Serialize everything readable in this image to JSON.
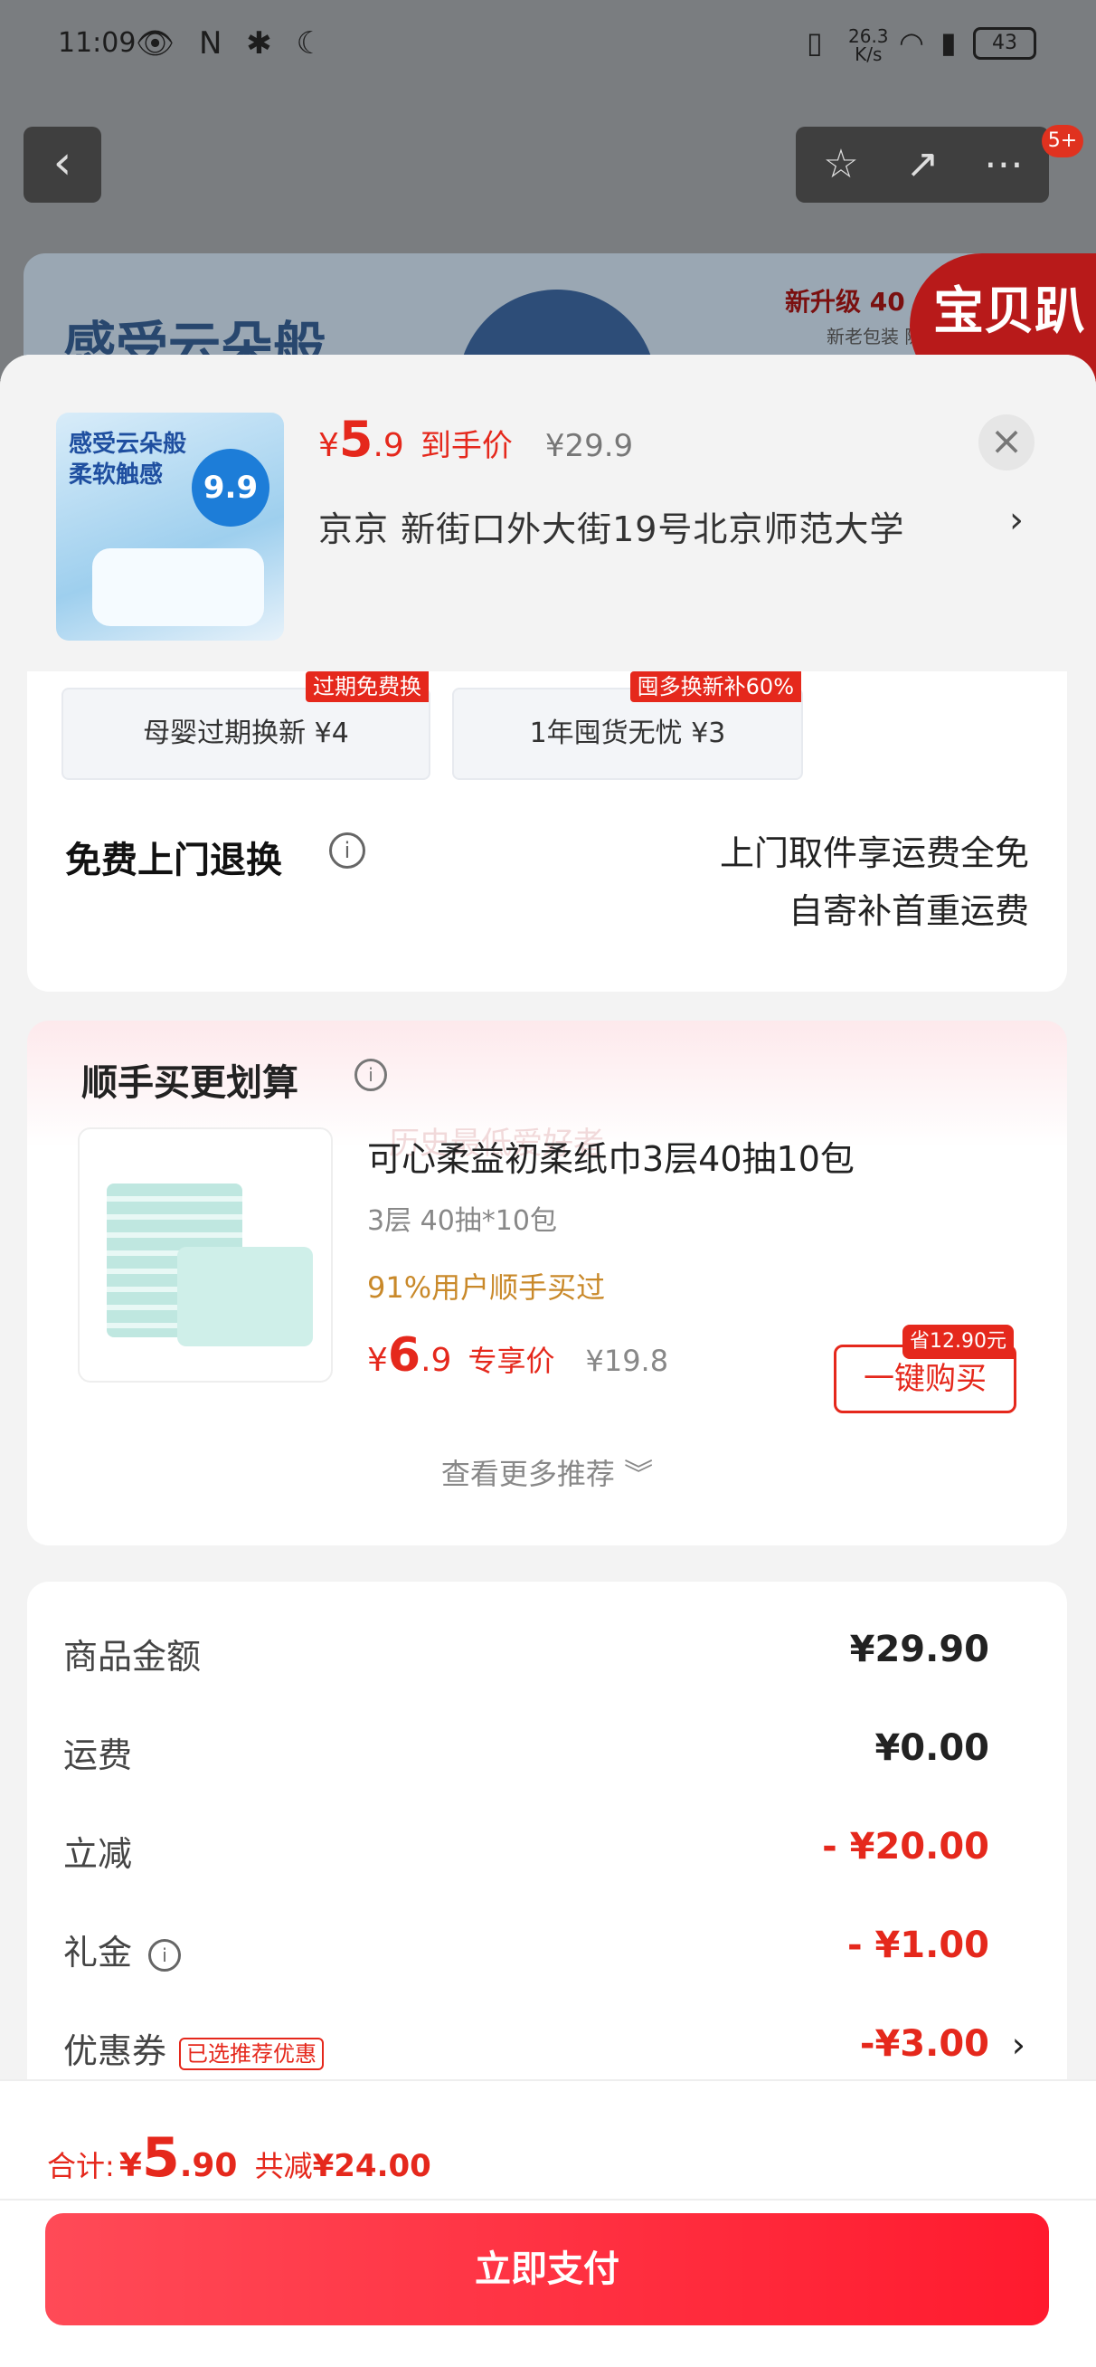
{
  "status_bar": {
    "time": "11:09",
    "net_speed": "26.3",
    "net_unit": "K/s",
    "battery": "43"
  },
  "nav": {
    "badge": "5+"
  },
  "banner": {
    "headline": "感受云朵般",
    "upgrade": "新升级 40",
    "sub": "新老包装 随",
    "brand_tag": "宝贝趴"
  },
  "product": {
    "thumb_line1": "感受云朵般",
    "thumb_line2": "柔软触感",
    "thumb_coin": "9.9",
    "currency": "¥",
    "price_int": "5",
    "price_dec": ".9",
    "price_label": "到手价",
    "orig_price": "¥29.9",
    "address": "京京   新街口外大街19号北京师范大学",
    "address_arrow": "›",
    "close": "×"
  },
  "services": {
    "chips": [
      {
        "tag": "过期免费换",
        "label": "母婴过期换新   ¥4"
      },
      {
        "tag": "囤多换新补60%",
        "label": "1年囤货无忧   ¥3"
      }
    ],
    "return_title": "免费上门退换",
    "return_line1": "上门取件享运费全免",
    "return_line2": "自寄补首重运费"
  },
  "recommend": {
    "title": "顺手买更划算",
    "ghost_text": "历史最低爱好者",
    "item_name": "可心柔益初柔纸巾3层40抽10包",
    "item_spec": "3层  40抽*10包",
    "item_hint": "91%用户顺手买过",
    "currency": "¥",
    "price_int": "6",
    "price_dec": ".9",
    "price_label": "专享价",
    "orig_price": "¥19.8",
    "buy_label": "一键购买",
    "save_tag": "省12.90元",
    "more": "查看更多推荐 ︾"
  },
  "summary": {
    "rows": [
      {
        "label": "商品金额",
        "value": "¥29.90"
      },
      {
        "label": "运费",
        "value": "¥0.00"
      },
      {
        "label": "立减",
        "value": "- ¥20.00"
      },
      {
        "label": "礼金",
        "value": "- ¥1.00"
      },
      {
        "label": "优惠券",
        "value": "-¥3.00",
        "tag": "已选推荐优惠"
      }
    ]
  },
  "footer": {
    "total_label": "合计:",
    "currency": "¥",
    "total_int": "5",
    "total_dec": ".90",
    "save_label": "共减",
    "save_amount": "¥24.00",
    "pay_label": "立即支付"
  },
  "colors": {
    "accent": "#e5281c",
    "pay_gradient_start": "#ff4a57",
    "pay_gradient_end": "#ff1a2e",
    "hint": "#c9892a"
  }
}
